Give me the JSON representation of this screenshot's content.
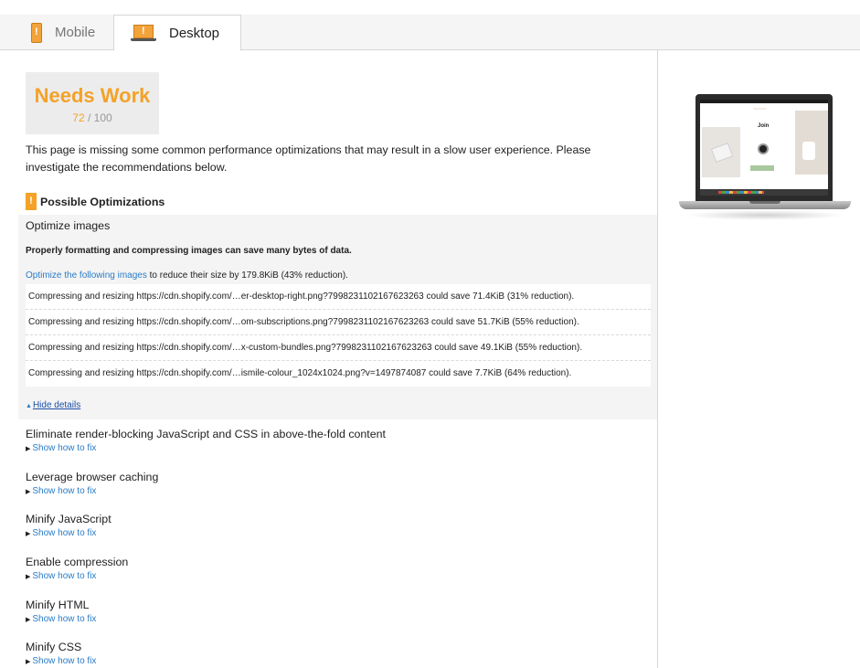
{
  "tabs": [
    {
      "label": "Mobile",
      "icon": "mobile-warning-icon",
      "active": false
    },
    {
      "label": "Desktop",
      "icon": "desktop-warning-icon",
      "active": true
    }
  ],
  "score": {
    "label": "Needs Work",
    "value": "72",
    "max": "/ 100",
    "color": "#f4a228"
  },
  "summary": "This page is missing some common performance optimizations that may result in a slow user experience. Please investigate the recommendations below.",
  "section": {
    "title": "Possible Optimizations",
    "icon": "warning-icon"
  },
  "optimize_images": {
    "title": "Optimize images",
    "description": "Properly formatting and compressing images can save many bytes of data.",
    "link_text": "Optimize the following images",
    "reduce_text": " to reduce their size by 179.8KiB (43% reduction).",
    "rows": [
      "Compressing and resizing https://cdn.shopify.com/…er-desktop-right.png?7998231102167623263 could save 71.4KiB (31% reduction).",
      "Compressing and resizing https://cdn.shopify.com/…om-subscriptions.png?7998231102167623263 could save 51.7KiB (55% reduction).",
      "Compressing and resizing https://cdn.shopify.com/…x-custom-bundles.png?7998231102167623263 could save 49.1KiB (55% reduction).",
      "Compressing and resizing https://cdn.shopify.com/…ismile-colour_1024x1024.png?v=1497874087 could save 7.7KiB (64% reduction)."
    ],
    "hide_details": "Hide details"
  },
  "other_optimizations": [
    {
      "name": "Eliminate render-blocking JavaScript and CSS in above-the-fold content",
      "fix": "Show how to fix"
    },
    {
      "name": "Leverage browser caching",
      "fix": "Show how to fix"
    },
    {
      "name": "Minify JavaScript",
      "fix": "Show how to fix"
    },
    {
      "name": "Enable compression",
      "fix": "Show how to fix"
    },
    {
      "name": "Minify HTML",
      "fix": "Show how to fix"
    },
    {
      "name": "Minify CSS",
      "fix": "Show how to fix"
    }
  ],
  "preview": {
    "join_text": "Join"
  },
  "colors": {
    "accent": "#f4a228",
    "link": "#2a7cc7"
  }
}
